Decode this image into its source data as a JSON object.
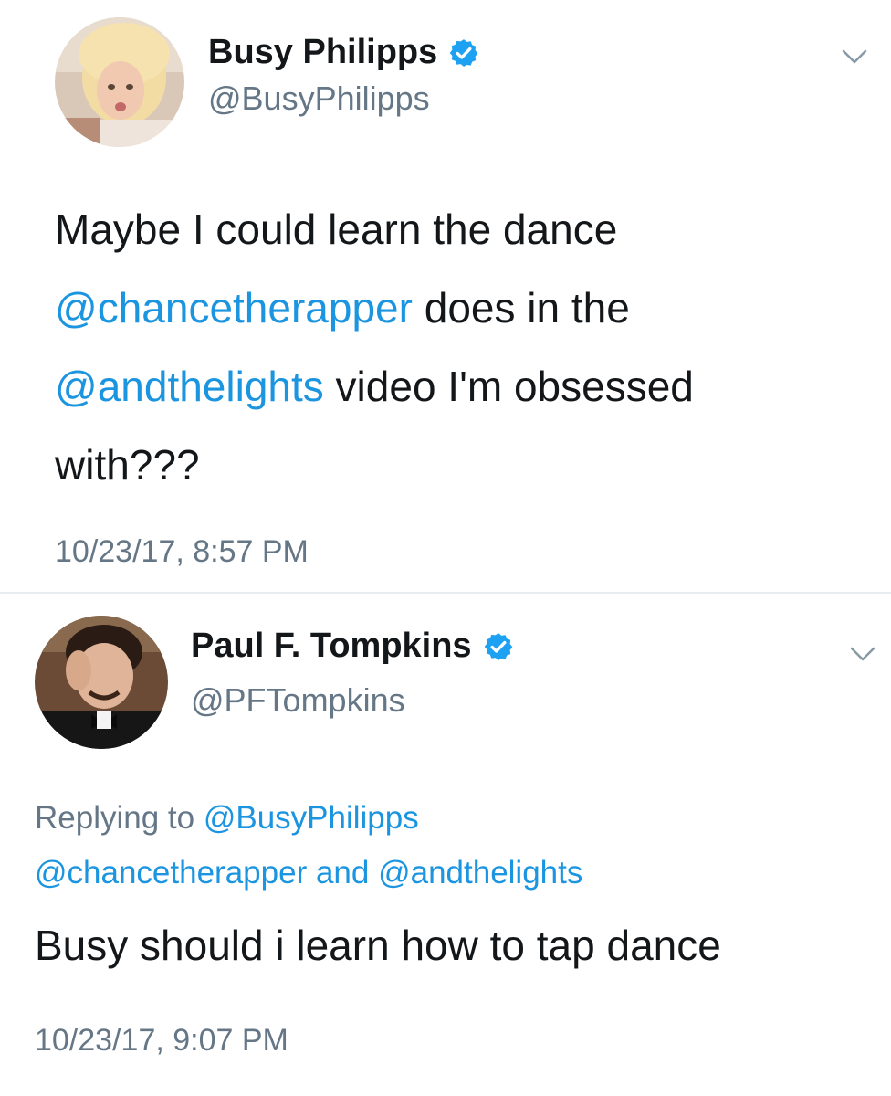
{
  "tweets": [
    {
      "author": {
        "name": "Busy Philipps",
        "handle": "@BusyPhilipps",
        "verified": true,
        "avatar_icon": "user-avatar"
      },
      "body_lines": [
        [
          {
            "text": "Maybe I could learn the dance",
            "mention": false
          }
        ],
        [
          {
            "text": "@chancetherapper",
            "mention": true
          },
          {
            "text": " does in the",
            "mention": false
          }
        ],
        [
          {
            "text": "@andthelights",
            "mention": true
          },
          {
            "text": " video I'm obsessed",
            "mention": false
          }
        ],
        [
          {
            "text": "with???",
            "mention": false
          }
        ]
      ],
      "timestamp": "10/23/17, 8:57 PM"
    },
    {
      "author": {
        "name": "Paul F. Tompkins",
        "handle": "@PFTompkins",
        "verified": true,
        "avatar_icon": "user-avatar"
      },
      "replying_to": {
        "prefix": "Replying to ",
        "first": "@BusyPhilipps",
        "second": "@chancetherapper",
        "and": " and ",
        "third": "@andthelights"
      },
      "body": "Busy should i learn how to tap dance",
      "timestamp": "10/23/17, 9:07 PM"
    }
  ],
  "colors": {
    "text": "#14171a",
    "secondary": "#657786",
    "mention": "#1b95e0",
    "verified": "#1da1f2",
    "separator": "#e6ecf0"
  }
}
